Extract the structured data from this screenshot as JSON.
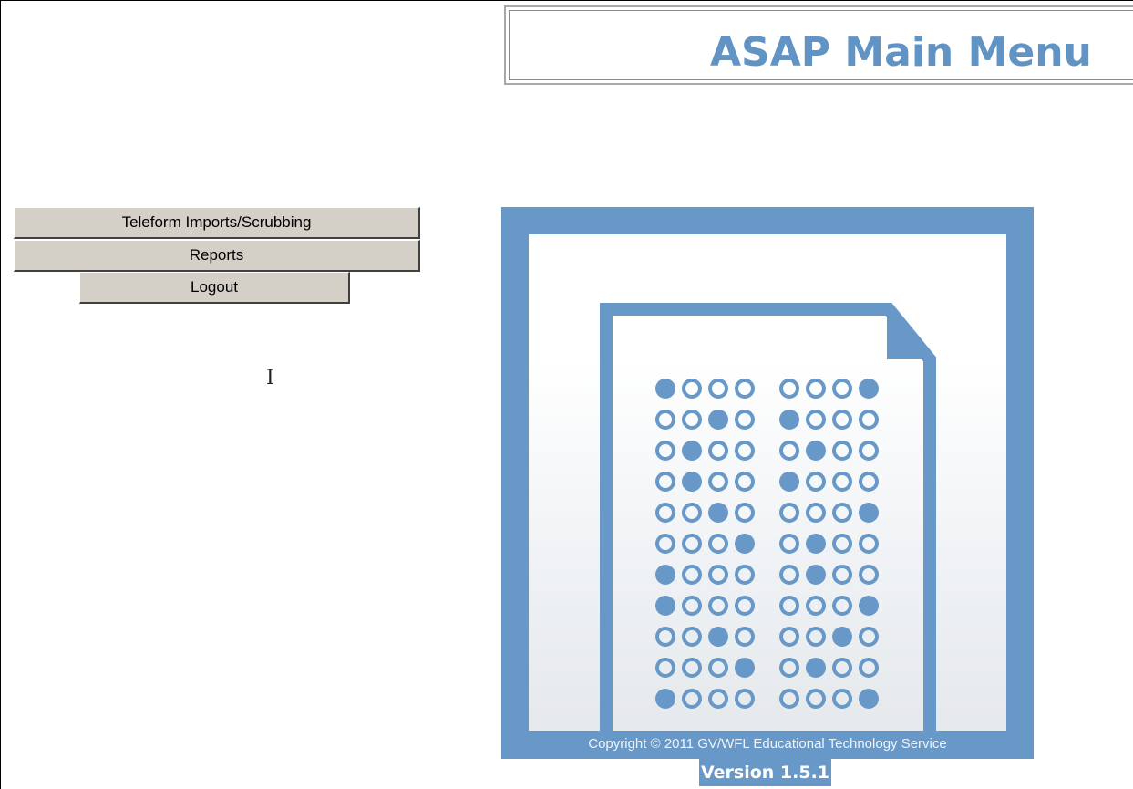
{
  "header": {
    "title": "ASAP Main Menu"
  },
  "menu": {
    "buttons": [
      {
        "label": "Teleform Imports/Scrubbing"
      },
      {
        "label": "Reports"
      },
      {
        "label": "Logout"
      }
    ]
  },
  "logo": {
    "icon": "bubble-answer-sheet-icon",
    "copyright": "Copyright © 2011 GV/WFL Educational Technology Service",
    "bubble_rows": [
      [
        "0",
        "3"
      ],
      [
        "2",
        "0"
      ],
      [
        "1",
        "1"
      ],
      [
        "1",
        "0"
      ],
      [
        "2",
        "3"
      ],
      [
        "3",
        "1"
      ],
      [
        "0",
        "1"
      ],
      [
        "0",
        "3"
      ],
      [
        "2",
        "2"
      ],
      [
        "3",
        "1"
      ],
      [
        "0",
        "3"
      ]
    ]
  },
  "footer": {
    "version": "Version 1.5.1"
  },
  "colors": {
    "accent": "#6798c7",
    "title": "#6193c4",
    "button": "#d4d0c8"
  }
}
